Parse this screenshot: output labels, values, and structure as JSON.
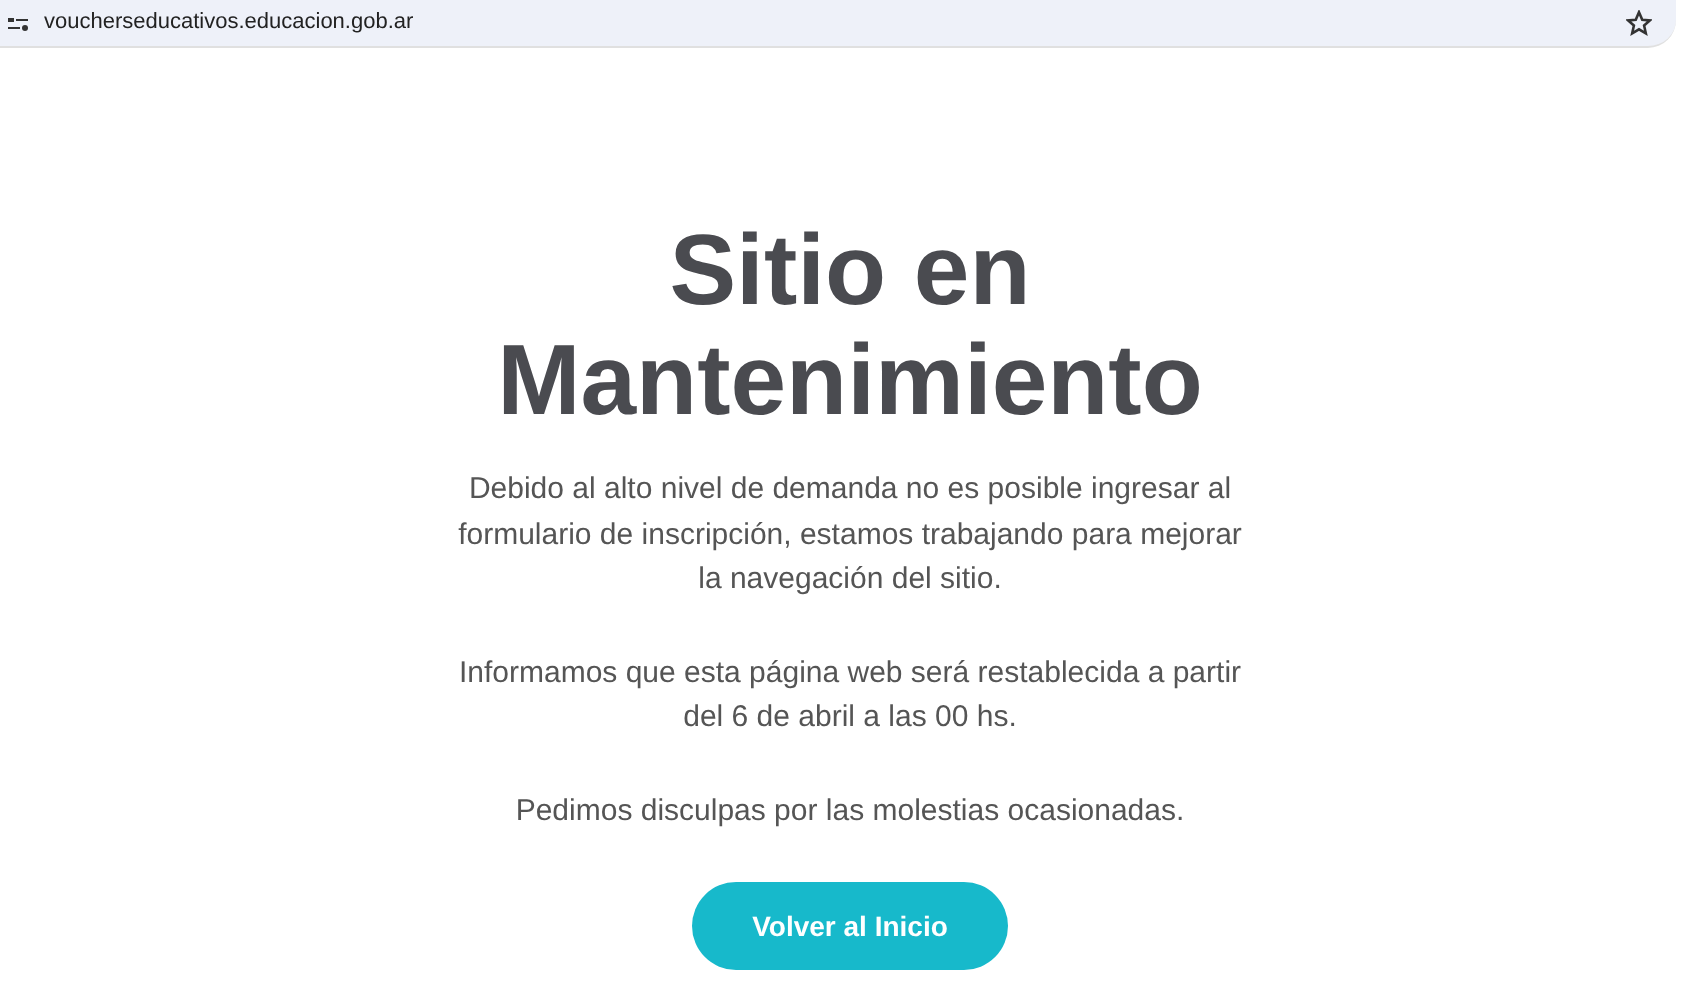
{
  "address_bar": {
    "url": "voucherseducativos.educacion.gob.ar"
  },
  "page": {
    "title": "Sitio en Mantenimiento",
    "paragraphs": [
      "Debido al alto nivel de demanda no es posible ingresar al formulario de inscripción, estamos trabajando para mejorar la navegación del sitio.",
      "Informamos que esta página web será restablecida a partir del 6 de abril a las 00 hs.",
      "Pedimos disculpas por las molestias ocasionadas."
    ],
    "button": "Volver al Inicio"
  }
}
